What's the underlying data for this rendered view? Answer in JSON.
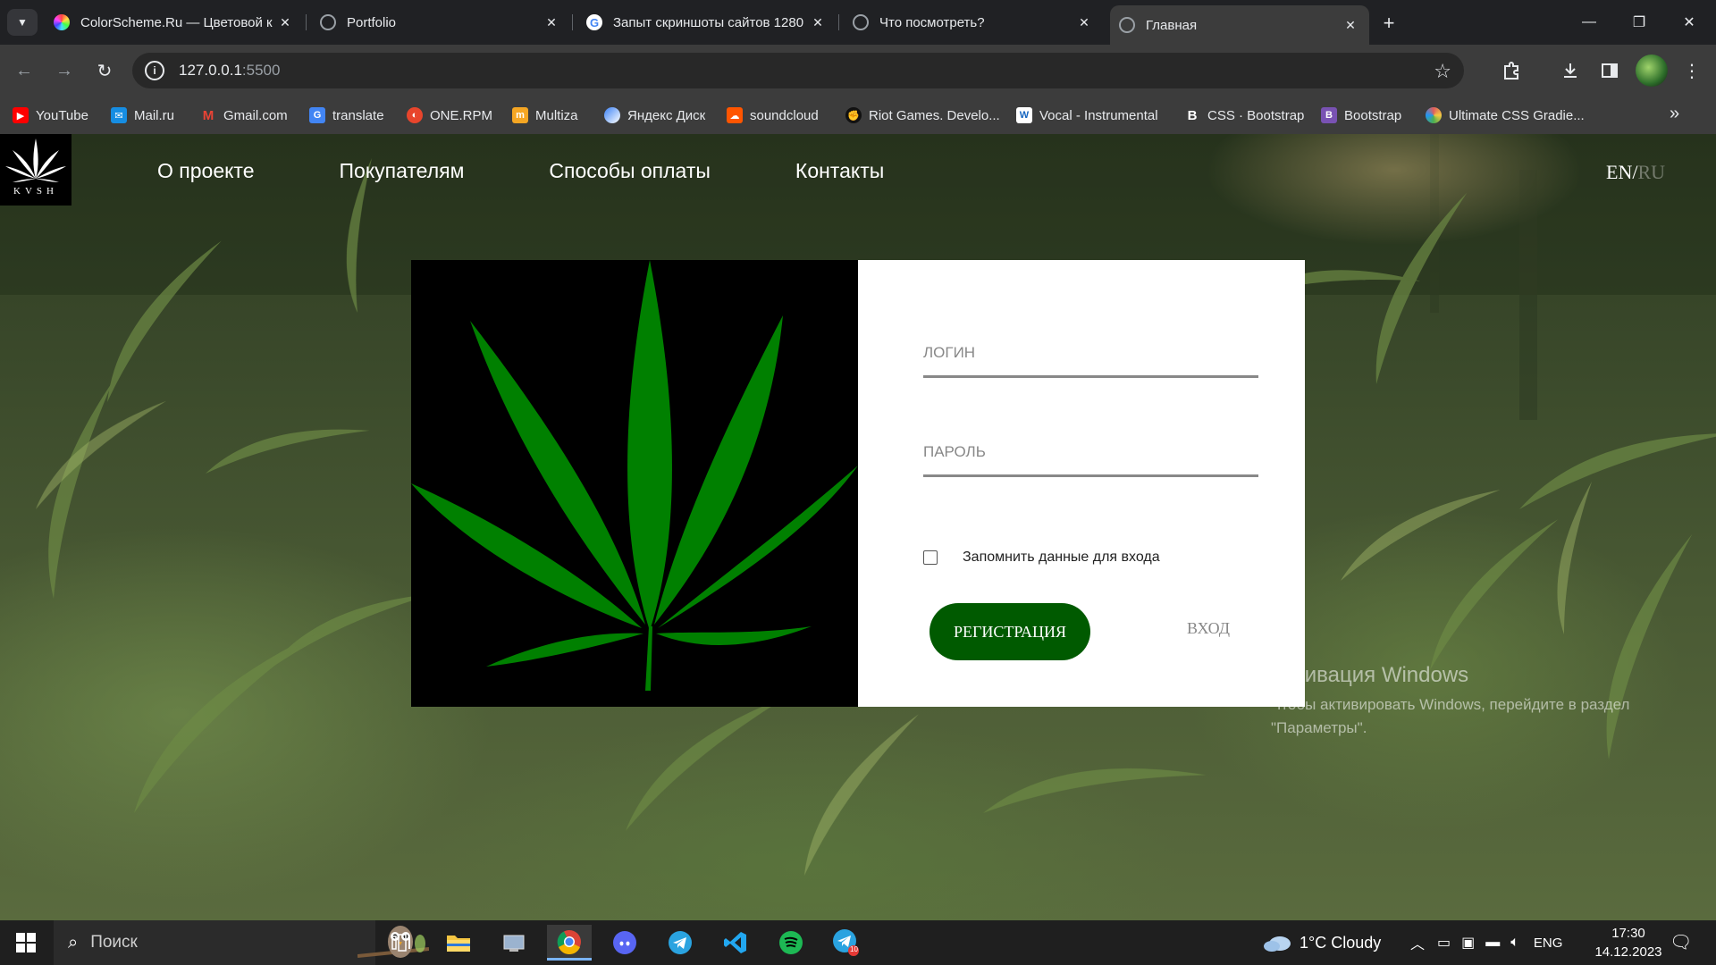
{
  "browser": {
    "tabs": [
      {
        "title": "ColorScheme.Ru — Цветовой к",
        "favicon": "colorwheel-icon",
        "active": false
      },
      {
        "title": "Portfolio",
        "favicon": "globe-icon",
        "active": false
      },
      {
        "title": "Запыт скриншоты сайтов 1280",
        "favicon": "google-icon",
        "active": false
      },
      {
        "title": "Что посмотреть?",
        "favicon": "globe-icon",
        "active": false
      },
      {
        "title": "Главная",
        "favicon": "globe-icon",
        "active": true
      }
    ],
    "url_host": "127.0.0.1",
    "url_port": ":5500",
    "bookmarks": [
      {
        "label": "YouTube",
        "icon": "youtube-icon",
        "color": "#ff0000"
      },
      {
        "label": "Mail.ru",
        "icon": "mailru-icon",
        "color": "#168de2"
      },
      {
        "label": "Gmail.com",
        "icon": "gmail-icon",
        "color": "#ea4335"
      },
      {
        "label": "translate",
        "icon": "translate-icon",
        "color": "#4285f4"
      },
      {
        "label": "ONE.RPM",
        "icon": "onerpm-icon",
        "color": "#e8452c"
      },
      {
        "label": "Multiza",
        "icon": "multiza-icon",
        "color": "#f5a623"
      },
      {
        "label": "Яндекс Диск",
        "icon": "yandex-disk-icon",
        "color": "#3b82f6"
      },
      {
        "label": "soundcloud",
        "icon": "soundcloud-icon",
        "color": "#ff5500"
      },
      {
        "label": "Riot Games. Develo...",
        "icon": "riot-icon",
        "color": "#111111"
      },
      {
        "label": "Vocal - Instrumental",
        "icon": "vocal-icon",
        "color": "#ffffff"
      },
      {
        "label": "CSS · Bootstrap",
        "icon": "bootstrap-icon",
        "color": "#7952b3"
      },
      {
        "label": "Bootstrap",
        "icon": "bootstrap-icon",
        "color": "#7952b3"
      },
      {
        "label": "Ultimate CSS Gradie...",
        "icon": "gradient-icon",
        "color": "#e05d5d"
      }
    ]
  },
  "site": {
    "logo_text": "KVSH",
    "nav": [
      "О проекте",
      "Покупателям",
      "Способы оплаты",
      "Контакты"
    ],
    "lang_active": "EN/",
    "lang_inactive": "RU",
    "form": {
      "login_label": "ЛОГИН",
      "password_label": "ПАРОЛЬ",
      "remember_label": "Запомнить данные для входа",
      "register_button": "РЕГИСТРАЦИЯ",
      "login_button": "ВХОД"
    },
    "accent_color": "#005a00",
    "leaf_color": "#008000"
  },
  "windows": {
    "activation_title": "Активация Windows",
    "activation_text": "Чтобы активировать Windows, перейдите в раздел \"Параметры\".",
    "search_placeholder": "Поиск",
    "weather": "1°C  Cloudy",
    "language": "ENG",
    "time": "17:30",
    "date": "14.12.2023",
    "telegram_badge": "10"
  }
}
